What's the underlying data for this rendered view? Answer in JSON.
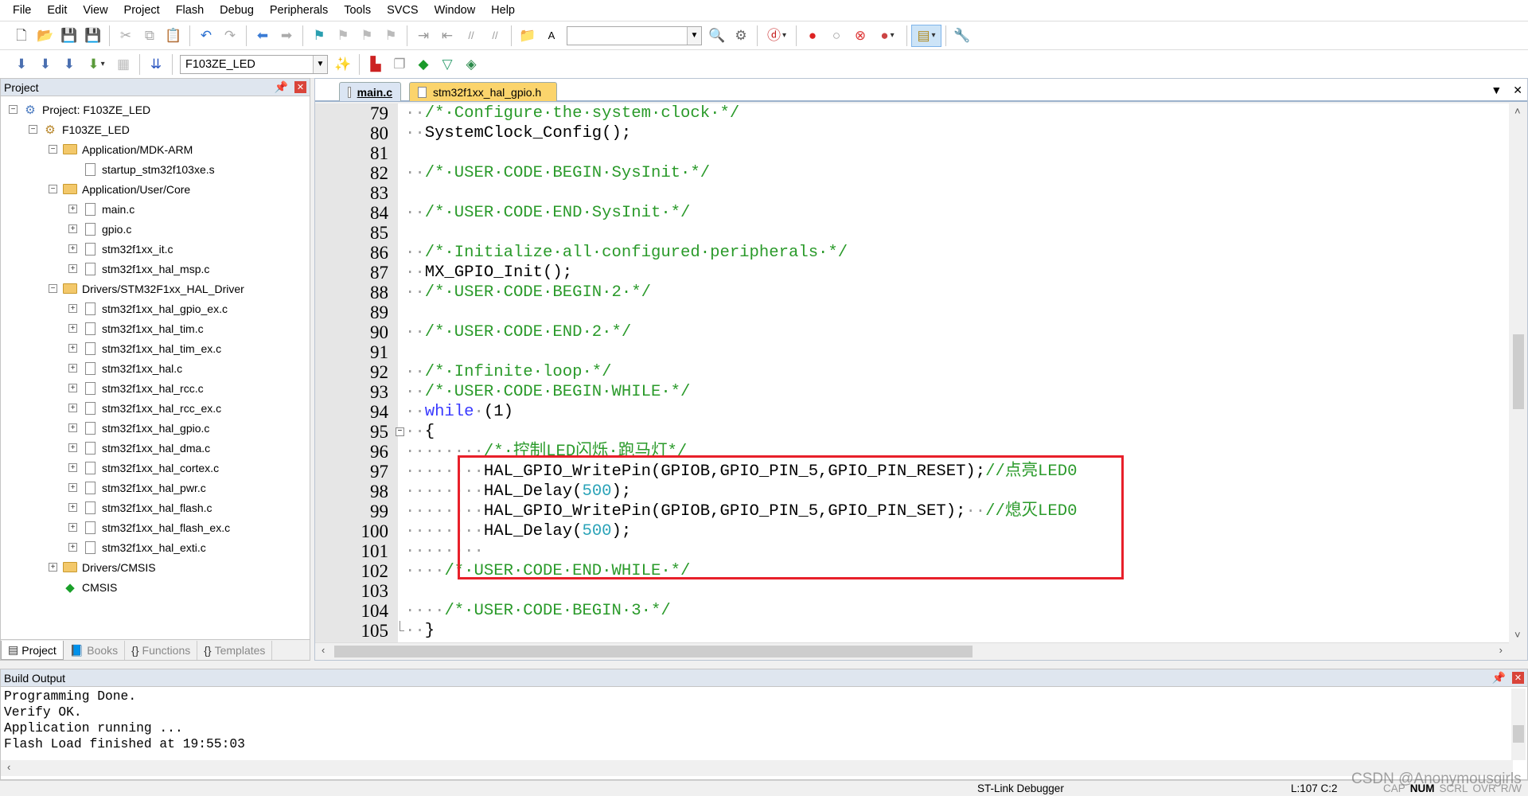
{
  "menu": [
    "File",
    "Edit",
    "View",
    "Project",
    "Flash",
    "Debug",
    "Peripherals",
    "Tools",
    "SVCS",
    "Window",
    "Help"
  ],
  "toolbar1": [
    {
      "icon": "new-file-icon",
      "g": "🗋",
      "c": "#555"
    },
    {
      "icon": "open-folder-icon",
      "g": "📂",
      "c": "#d9a632"
    },
    {
      "icon": "save-icon",
      "g": "💾",
      "c": "#3b4ea0"
    },
    {
      "icon": "save-all-icon",
      "g": "💾",
      "c": "#6a5aa8"
    },
    "|",
    {
      "icon": "cut-icon",
      "g": "✂",
      "c": "#aaa"
    },
    {
      "icon": "copy-icon",
      "g": "⧉",
      "c": "#aaa"
    },
    {
      "icon": "paste-icon",
      "g": "📋",
      "c": "#b58a2c"
    },
    "|",
    {
      "icon": "undo-icon",
      "g": "↶",
      "c": "#2a6fd0"
    },
    {
      "icon": "redo-icon",
      "g": "↷",
      "c": "#aaa"
    },
    "|",
    {
      "icon": "navigate-back-icon",
      "g": "⬅",
      "c": "#3a7bd5"
    },
    {
      "icon": "navigate-forward-icon",
      "g": "➡",
      "c": "#aaa"
    },
    "|",
    {
      "icon": "bookmark-icon",
      "g": "⚑",
      "c": "#2a9fb0"
    },
    {
      "icon": "previous-bookmark-icon",
      "g": "⚑",
      "c": "#bbb"
    },
    {
      "icon": "next-bookmark-icon",
      "g": "⚑",
      "c": "#bbb"
    },
    {
      "icon": "clear-bookmarks-icon",
      "g": "⚑",
      "c": "#bbb"
    },
    "|",
    {
      "icon": "indent-icon",
      "g": "⇥",
      "c": "#999"
    },
    {
      "icon": "unindent-icon",
      "g": "⇤",
      "c": "#999"
    },
    {
      "icon": "comment-icon",
      "g": "//",
      "c": "#999"
    },
    {
      "icon": "uncomment-icon",
      "g": "//",
      "c": "#999"
    },
    "|",
    {
      "icon": "find-in-files-icon",
      "g": "📁",
      "c": "#c9962c"
    },
    {
      "icon": "find-text-icon",
      "g": "A",
      "c": "#000"
    },
    {
      "combo": "find-combo",
      "value": "",
      "w": 170
    },
    {
      "icon": "incremental-find-icon",
      "g": "🔍",
      "c": "#555"
    },
    {
      "icon": "debug-session-icon",
      "g": "⚙",
      "c": "#666"
    },
    "|",
    {
      "icon": "start-debug-icon",
      "g": "ⓓ",
      "c": "#c62020",
      "dd": true
    },
    "|",
    {
      "icon": "insert-breakpoint-icon",
      "g": "●",
      "c": "#d22"
    },
    {
      "icon": "enable-breakpoint-icon",
      "g": "○",
      "c": "#999"
    },
    {
      "icon": "disable-breakpoints-icon",
      "g": "⊗",
      "c": "#d33"
    },
    {
      "icon": "kill-breakpoints-icon",
      "g": "●",
      "c": "#c44",
      "dd": true
    },
    "|",
    {
      "icon": "window-layout-icon",
      "g": "▤",
      "c": "#b08a20",
      "dd": true,
      "hl": true
    },
    "|",
    {
      "icon": "configure-icon",
      "g": "🔧",
      "c": "#555"
    }
  ],
  "toolbar2": [
    {
      "icon": "translate-icon",
      "g": "⬇",
      "c": "#4a6fb0"
    },
    {
      "icon": "build-icon",
      "g": "⬇",
      "c": "#4a6fb0"
    },
    {
      "icon": "rebuild-icon",
      "g": "⬇",
      "c": "#4a6fb0"
    },
    {
      "icon": "batch-build-icon",
      "g": "⬇",
      "c": "#5a9a3a",
      "dd": true
    },
    {
      "icon": "stop-build-icon",
      "g": "▦",
      "c": "#bbb"
    },
    "|",
    {
      "icon": "download-load-icon",
      "g": "⇊",
      "c": "#2a55c0"
    },
    "|",
    {
      "combo": "target-select",
      "value": "F103ZE_LED",
      "w": 186
    },
    {
      "icon": "options-for-target-icon",
      "g": "✨",
      "c": "#335"
    },
    "|",
    {
      "icon": "manage-project-items-icon",
      "g": "▙",
      "c": "#c22"
    },
    {
      "icon": "select-packs-icon",
      "g": "❐",
      "c": "#999"
    },
    {
      "icon": "manage-run-time-environment-icon",
      "g": "◆",
      "c": "#1a9a2a"
    },
    {
      "icon": "pack-installer-icon",
      "g": "▽",
      "c": "#2a9a6a"
    },
    {
      "icon": "device-database-icon",
      "g": "◈",
      "c": "#2a8a4a"
    }
  ],
  "project_panel": {
    "title": "Project",
    "tree": [
      {
        "label": "Project: F103ZE_LED",
        "level": 0,
        "exp": "−",
        "icon": "project-icon"
      },
      {
        "label": "F103ZE_LED",
        "level": 1,
        "exp": "−",
        "icon": "target-icon"
      },
      {
        "label": "Application/MDK-ARM",
        "level": 2,
        "exp": "−",
        "icon": "folder-icon"
      },
      {
        "label": "startup_stm32f103xe.s",
        "level": 3,
        "exp": "",
        "icon": "file-icon"
      },
      {
        "label": "Application/User/Core",
        "level": 2,
        "exp": "−",
        "icon": "folder-icon"
      },
      {
        "label": "main.c",
        "level": 3,
        "exp": "+",
        "icon": "file-icon"
      },
      {
        "label": "gpio.c",
        "level": 3,
        "exp": "+",
        "icon": "file-icon"
      },
      {
        "label": "stm32f1xx_it.c",
        "level": 3,
        "exp": "+",
        "icon": "file-icon"
      },
      {
        "label": "stm32f1xx_hal_msp.c",
        "level": 3,
        "exp": "+",
        "icon": "file-icon"
      },
      {
        "label": "Drivers/STM32F1xx_HAL_Driver",
        "level": 2,
        "exp": "−",
        "icon": "folder-icon"
      },
      {
        "label": "stm32f1xx_hal_gpio_ex.c",
        "level": 3,
        "exp": "+",
        "icon": "file-icon"
      },
      {
        "label": "stm32f1xx_hal_tim.c",
        "level": 3,
        "exp": "+",
        "icon": "file-icon"
      },
      {
        "label": "stm32f1xx_hal_tim_ex.c",
        "level": 3,
        "exp": "+",
        "icon": "file-icon"
      },
      {
        "label": "stm32f1xx_hal.c",
        "level": 3,
        "exp": "+",
        "icon": "file-icon"
      },
      {
        "label": "stm32f1xx_hal_rcc.c",
        "level": 3,
        "exp": "+",
        "icon": "file-icon"
      },
      {
        "label": "stm32f1xx_hal_rcc_ex.c",
        "level": 3,
        "exp": "+",
        "icon": "file-icon"
      },
      {
        "label": "stm32f1xx_hal_gpio.c",
        "level": 3,
        "exp": "+",
        "icon": "file-icon"
      },
      {
        "label": "stm32f1xx_hal_dma.c",
        "level": 3,
        "exp": "+",
        "icon": "file-icon"
      },
      {
        "label": "stm32f1xx_hal_cortex.c",
        "level": 3,
        "exp": "+",
        "icon": "file-icon"
      },
      {
        "label": "stm32f1xx_hal_pwr.c",
        "level": 3,
        "exp": "+",
        "icon": "file-icon"
      },
      {
        "label": "stm32f1xx_hal_flash.c",
        "level": 3,
        "exp": "+",
        "icon": "file-icon"
      },
      {
        "label": "stm32f1xx_hal_flash_ex.c",
        "level": 3,
        "exp": "+",
        "icon": "file-icon"
      },
      {
        "label": "stm32f1xx_hal_exti.c",
        "level": 3,
        "exp": "+",
        "icon": "file-icon"
      },
      {
        "label": "Drivers/CMSIS",
        "level": 2,
        "exp": "+",
        "icon": "folder-icon"
      },
      {
        "label": "CMSIS",
        "level": 2,
        "exp": "",
        "icon": "cmsis-diamond-icon"
      }
    ],
    "tabs": [
      {
        "label": "Project",
        "icon": "project-tab-icon",
        "g": "▤"
      },
      {
        "label": "Books",
        "icon": "books-icon",
        "g": "📘"
      },
      {
        "label": "Functions",
        "icon": "functions-icon",
        "g": "{}"
      },
      {
        "label": "Templates",
        "icon": "templates-icon",
        "g": "{}"
      }
    ]
  },
  "editor": {
    "tabs": [
      {
        "label": "main.c",
        "active": true
      },
      {
        "label": "stm32f1xx_hal_gpio.h",
        "active": false
      }
    ],
    "lines": [
      {
        "n": "79",
        "segs": [
          [
            "ws",
            "··"
          ],
          [
            "c",
            "/*·Configure·the·system·clock·*/"
          ]
        ]
      },
      {
        "n": "80",
        "segs": [
          [
            "ws",
            "··"
          ],
          [
            "p",
            "SystemClock_Config();"
          ]
        ]
      },
      {
        "n": "81",
        "segs": []
      },
      {
        "n": "82",
        "segs": [
          [
            "ws",
            "··"
          ],
          [
            "c",
            "/*·USER·CODE·BEGIN·SysInit·*/"
          ]
        ]
      },
      {
        "n": "83",
        "segs": []
      },
      {
        "n": "84",
        "segs": [
          [
            "ws",
            "··"
          ],
          [
            "c",
            "/*·USER·CODE·END·SysInit·*/"
          ]
        ]
      },
      {
        "n": "85",
        "segs": []
      },
      {
        "n": "86",
        "segs": [
          [
            "ws",
            "··"
          ],
          [
            "c",
            "/*·Initialize·all·configured·peripherals·*/"
          ]
        ]
      },
      {
        "n": "87",
        "segs": [
          [
            "ws",
            "··"
          ],
          [
            "p",
            "MX_GPIO_Init();"
          ]
        ]
      },
      {
        "n": "88",
        "segs": [
          [
            "ws",
            "··"
          ],
          [
            "c",
            "/*·USER·CODE·BEGIN·2·*/"
          ]
        ]
      },
      {
        "n": "89",
        "segs": []
      },
      {
        "n": "90",
        "segs": [
          [
            "ws",
            "··"
          ],
          [
            "c",
            "/*·USER·CODE·END·2·*/"
          ]
        ]
      },
      {
        "n": "91",
        "segs": []
      },
      {
        "n": "92",
        "segs": [
          [
            "ws",
            "··"
          ],
          [
            "c",
            "/*·Infinite·loop·*/"
          ]
        ]
      },
      {
        "n": "93",
        "segs": [
          [
            "ws",
            "··"
          ],
          [
            "c",
            "/*·USER·CODE·BEGIN·WHILE·*/"
          ]
        ]
      },
      {
        "n": "94",
        "segs": [
          [
            "ws",
            "··"
          ],
          [
            "k",
            "while"
          ],
          [
            "ws",
            "·"
          ],
          [
            "p",
            "(1)"
          ]
        ]
      },
      {
        "n": "95",
        "fold": "start",
        "segs": [
          [
            "ws",
            "··"
          ],
          [
            "p",
            "{"
          ]
        ]
      },
      {
        "n": "96",
        "segs": [
          [
            "ws",
            "········"
          ],
          [
            "c",
            "/*·控制LED闪烁·跑马灯*/"
          ]
        ]
      },
      {
        "n": "97",
        "segs": [
          [
            "ws",
            "········"
          ],
          [
            "p",
            "HAL_GPIO_WritePin(GPIOB,GPIO_PIN_5,GPIO_PIN_RESET);"
          ],
          [
            "c",
            "//点亮LED0"
          ]
        ]
      },
      {
        "n": "98",
        "segs": [
          [
            "ws",
            "········"
          ],
          [
            "p",
            "HAL_Delay("
          ],
          [
            "n",
            "500"
          ],
          [
            "p",
            ");"
          ]
        ]
      },
      {
        "n": "99",
        "segs": [
          [
            "ws",
            "········"
          ],
          [
            "p",
            "HAL_GPIO_WritePin(GPIOB,GPIO_PIN_5,GPIO_PIN_SET);"
          ],
          [
            "ws",
            "··"
          ],
          [
            "c",
            "//熄灭LED0"
          ]
        ]
      },
      {
        "n": "100",
        "segs": [
          [
            "ws",
            "········"
          ],
          [
            "p",
            "HAL_Delay("
          ],
          [
            "n",
            "500"
          ],
          [
            "p",
            ");"
          ]
        ]
      },
      {
        "n": "101",
        "segs": [
          [
            "ws",
            "········"
          ]
        ]
      },
      {
        "n": "102",
        "segs": [
          [
            "ws",
            "····"
          ],
          [
            "c",
            "/*·USER·CODE·END·WHILE·*/"
          ]
        ]
      },
      {
        "n": "103",
        "segs": []
      },
      {
        "n": "104",
        "segs": [
          [
            "ws",
            "····"
          ],
          [
            "c",
            "/*·USER·CODE·BEGIN·3·*/"
          ]
        ]
      },
      {
        "n": "105",
        "fold": "end",
        "segs": [
          [
            "ws",
            "··"
          ],
          [
            "p",
            "}"
          ]
        ]
      }
    ],
    "highlight_color": "#e8202a"
  },
  "build_output": {
    "title": "Build Output",
    "lines": [
      "Programming Done.",
      "Verify OK.",
      "Application running ...",
      "Flash Load finished at 19:55:03"
    ]
  },
  "status": {
    "debugger": "ST-Link Debugger",
    "position": "L:107 C:2",
    "indicators": [
      "CAP",
      "NUM",
      "SCRL",
      "OVR",
      "R/W"
    ],
    "active_indicator": "NUM"
  },
  "watermark": "CSDN @Anonymousgirls"
}
